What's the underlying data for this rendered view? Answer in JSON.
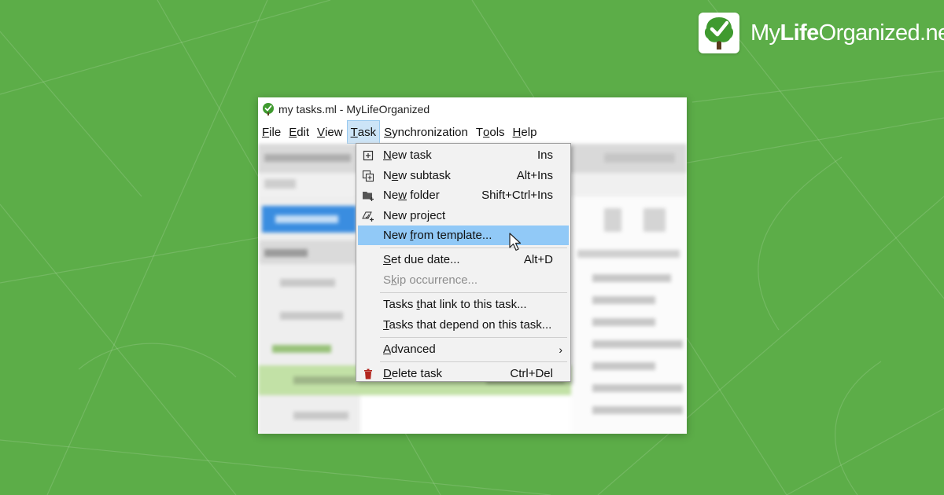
{
  "branding": {
    "part1": "My",
    "part2": "Life",
    "part3": "Organized",
    "part4": ".net"
  },
  "window": {
    "title": "my tasks.ml - MyLifeOrganized"
  },
  "menubar": {
    "items": [
      {
        "label": "File",
        "accel": "F"
      },
      {
        "label": "Edit",
        "accel": "E"
      },
      {
        "label": "View",
        "accel": "V"
      },
      {
        "label": "Task",
        "accel": "T",
        "active": true
      },
      {
        "label": "Synchronization",
        "accel": "S"
      },
      {
        "label": "Tools",
        "accel": "o"
      },
      {
        "label": "Help",
        "accel": "H"
      }
    ]
  },
  "task_menu": {
    "items": [
      {
        "label": "New task",
        "accel": "N",
        "shortcut": "Ins",
        "icon": "plus-box-icon"
      },
      {
        "label": "New subtask",
        "accel": "e",
        "shortcut": "Alt+Ins",
        "icon": "subtask-icon"
      },
      {
        "label": "New folder",
        "accel": "w",
        "shortcut": "Shift+Ctrl+Ins",
        "icon": "folder-plus-icon"
      },
      {
        "label": "New project",
        "accel": "j",
        "shortcut": "",
        "icon": "project-icon"
      },
      {
        "label": "New from template...",
        "accel": "f",
        "shortcut": "",
        "icon": "",
        "highlighted": true
      },
      {
        "separator": true
      },
      {
        "label": "Set due date...",
        "accel": "S",
        "shortcut": "Alt+D",
        "icon": ""
      },
      {
        "label": "Skip occurrence...",
        "accel": "k",
        "shortcut": "",
        "icon": "",
        "disabled": true
      },
      {
        "separator": true
      },
      {
        "label": "Tasks that link to this task...",
        "accel": "t",
        "shortcut": "",
        "icon": ""
      },
      {
        "label": "Tasks that depend on this task...",
        "accel": "T",
        "shortcut": "",
        "icon": ""
      },
      {
        "separator": true
      },
      {
        "label": "Advanced",
        "accel": "A",
        "shortcut": "",
        "icon": "",
        "submenu": true
      },
      {
        "separator": true
      },
      {
        "label": "Delete task",
        "accel": "D",
        "shortcut": "Ctrl+Del",
        "icon": "trash-icon"
      }
    ]
  },
  "colors": {
    "background": "#5cad48",
    "menu_highlight": "#91c9f7",
    "menubar_active": "#cce4f7",
    "trash_red": "#b3261e"
  }
}
